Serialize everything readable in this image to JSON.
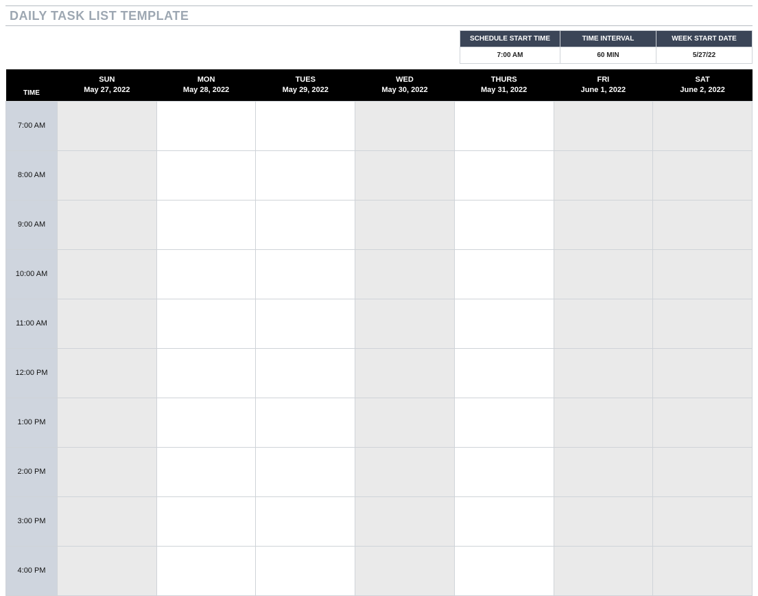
{
  "header": {
    "title": "DAILY TASK LIST TEMPLATE"
  },
  "config": {
    "headers": {
      "start_time": "SCHEDULE START TIME",
      "interval": "TIME INTERVAL",
      "week_start": "WEEK START DATE"
    },
    "values": {
      "start_time": "7:00 AM",
      "interval": "60 MIN",
      "week_start": "5/27/22"
    }
  },
  "schedule": {
    "corner_label": "TIME",
    "days": [
      {
        "dow": "SUN",
        "date": "May 27, 2022"
      },
      {
        "dow": "MON",
        "date": "May 28, 2022"
      },
      {
        "dow": "TUES",
        "date": "May 29, 2022"
      },
      {
        "dow": "WED",
        "date": "May 30, 2022"
      },
      {
        "dow": "THURS",
        "date": "May 31, 2022"
      },
      {
        "dow": "FRI",
        "date": "June 1, 2022"
      },
      {
        "dow": "SAT",
        "date": "June 2, 2022"
      }
    ],
    "times": [
      "7:00 AM",
      "8:00 AM",
      "9:00 AM",
      "10:00 AM",
      "11:00 AM",
      "12:00 PM",
      "1:00 PM",
      "2:00 PM",
      "3:00 PM",
      "4:00 PM"
    ],
    "shade_pattern": [
      "grey",
      "white",
      "white",
      "grey",
      "white",
      "grey",
      "grey"
    ]
  }
}
